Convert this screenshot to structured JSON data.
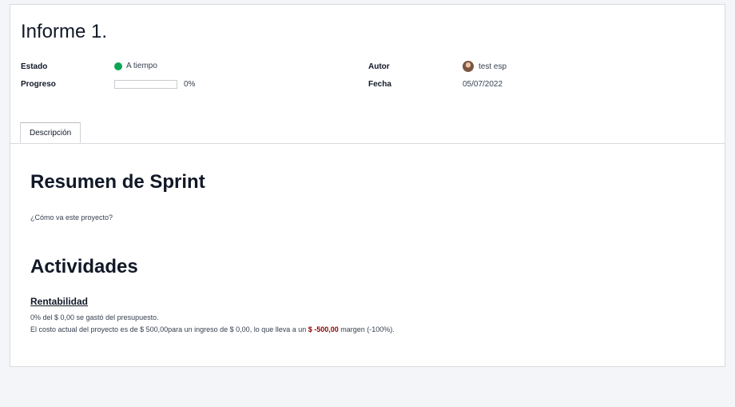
{
  "report": {
    "title": "Informe 1."
  },
  "fields": {
    "estado_label": "Estado",
    "estado_value": "A tiempo",
    "estado_color": "#0aa553",
    "progreso_label": "Progreso",
    "progreso_value": "0%",
    "progreso_fraction": 0,
    "autor_label": "Autor",
    "autor_value": "test esp",
    "fecha_label": "Fecha",
    "fecha_value": "05/07/2022"
  },
  "tabs": {
    "descripcion_label": "Descripción"
  },
  "content": {
    "sprint_heading": "Resumen de Sprint",
    "sprint_question": "¿Cómo va este proyecto?",
    "activities_heading": "Actividades",
    "rentabilidad_heading": "Rentabilidad",
    "budget_line": "0% del $ 0,00 se gastó del presupuesto.",
    "cost_line_prefix": "El costo actual del proyecto es de $ 500,00para un ingreso de $ 0,00, lo que lleva a un ",
    "cost_line_margin": "$ -500,00",
    "cost_line_suffix": " margen (-100%).",
    "margin_color": "#8b0000"
  }
}
